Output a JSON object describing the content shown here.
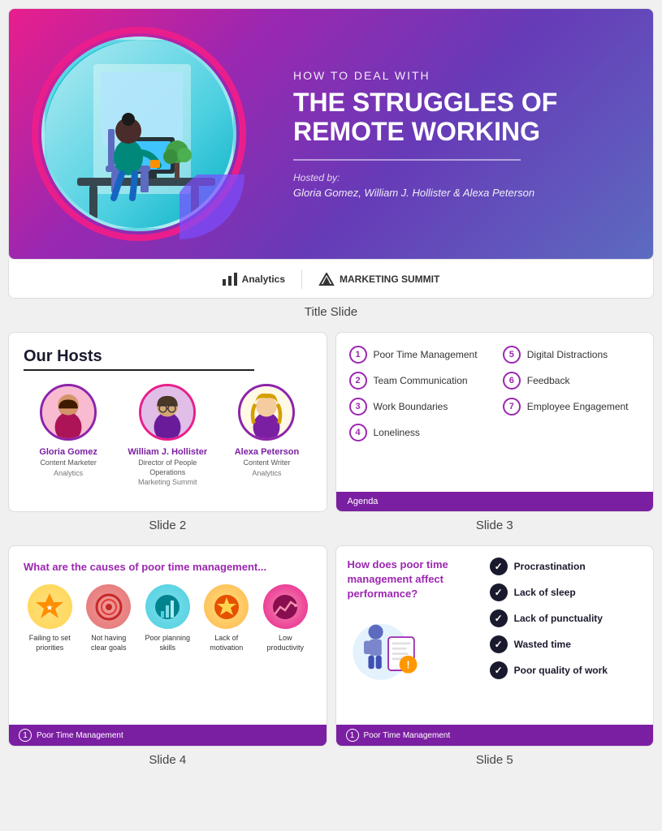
{
  "titleSlide": {
    "subtitle": "HOW TO DEAL WITH",
    "title": "THE STRUGGLES OF REMOTE WORKING",
    "hostedBy": "Hosted by:",
    "hosts": "Gloria Gomez, William J. Hollister & Alexa Peterson"
  },
  "logos": {
    "analytics": "Analytics",
    "marketingSummit": "MARKETING SUMMIT"
  },
  "slideLabels": {
    "slide1": "Title Slide",
    "slide2": "Slide 2",
    "slide3": "Slide 3",
    "slide4": "Slide 4",
    "slide5": "Slide 5"
  },
  "slide2": {
    "title": "Our Hosts",
    "hosts": [
      {
        "name": "Gloria Gomez",
        "role": "Content Marketer",
        "company": "Analytics",
        "emoji": "👩"
      },
      {
        "name": "William J. Hollister",
        "role": "Director of People Operations",
        "company": "Marketing Summit",
        "emoji": "👨"
      },
      {
        "name": "Alexa Peterson",
        "role": "Content Writer",
        "company": "Analytics",
        "emoji": "👱‍♀️"
      }
    ]
  },
  "slide3": {
    "agendaItems": [
      {
        "number": "1",
        "label": "Poor Time Management"
      },
      {
        "number": "5",
        "label": "Digital Distractions"
      },
      {
        "number": "2",
        "label": "Team Communication"
      },
      {
        "number": "6",
        "label": "Feedback"
      },
      {
        "number": "3",
        "label": "Work Boundaries"
      },
      {
        "number": "7",
        "label": "Employee Engagement"
      },
      {
        "number": "4",
        "label": "Loneliness"
      },
      {
        "number": "",
        "label": ""
      }
    ],
    "footer": "Agenda"
  },
  "slide4": {
    "title": "What are the causes of poor time management...",
    "causes": [
      {
        "label": "Failing to set priorities",
        "emoji": "🏆",
        "bg": "#ffd54f"
      },
      {
        "label": "Not having clear goals",
        "emoji": "🎯",
        "bg": "#ef9a9a"
      },
      {
        "label": "Poor planning skills",
        "emoji": "📊",
        "bg": "#80cbc4"
      },
      {
        "label": "Lack of motivation",
        "emoji": "⭐",
        "bg": "#ffb74d"
      },
      {
        "label": "Low productivity",
        "emoji": "📈",
        "bg": "#f48fb1"
      }
    ],
    "footer": "Poor Time Management",
    "footerNum": "1"
  },
  "slide5": {
    "question": "How does poor time management affect performance?",
    "checkItems": [
      "Procrastination",
      "Lack of sleep",
      "Lack of punctuality",
      "Wasted time",
      "Poor quality of work"
    ],
    "footer": "Poor Time Management",
    "footerNum": "1"
  }
}
